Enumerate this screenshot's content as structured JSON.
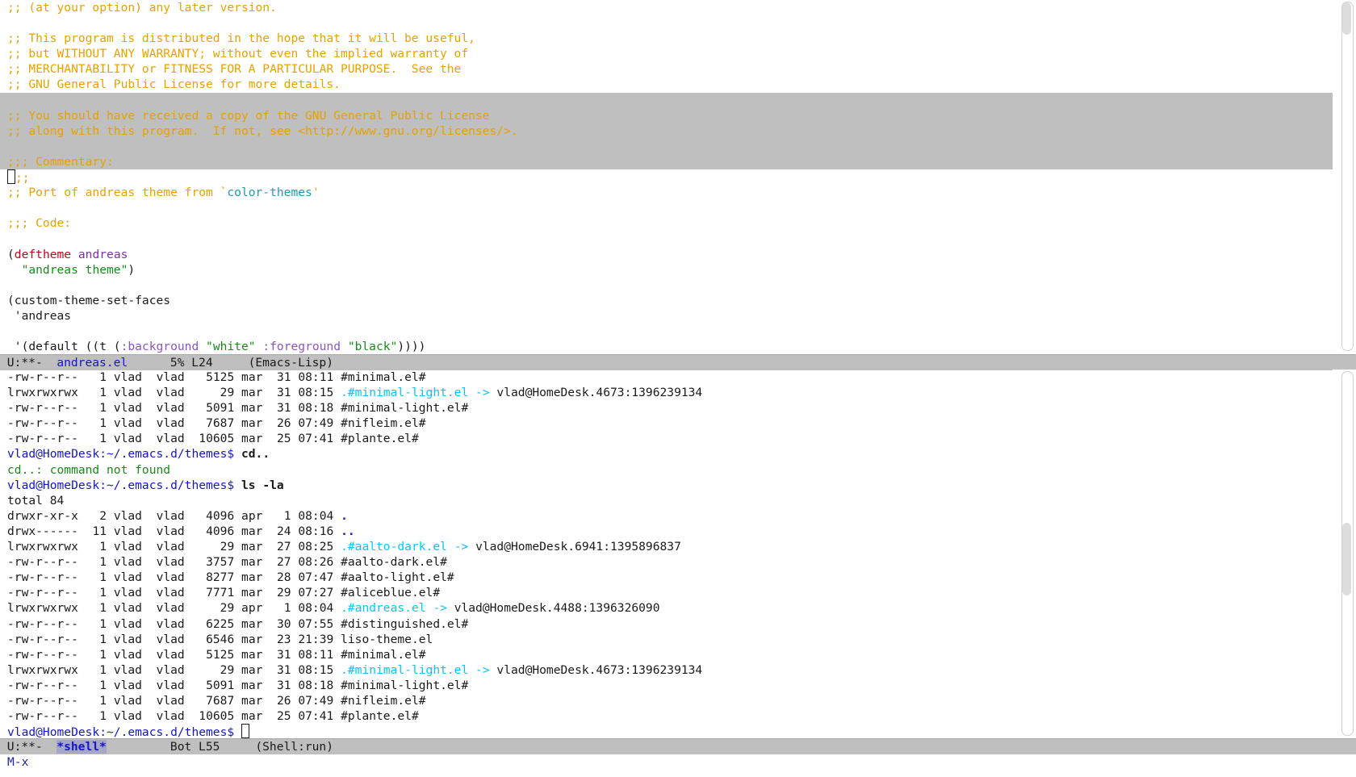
{
  "editor": {
    "lines": [
      ";; (at your option) any later version.",
      "",
      ";; This program is distributed in the hope that it will be useful,",
      ";; but WITHOUT ANY WARRANTY; without even the implied warranty of",
      ";; MERCHANTABILITY or FITNESS FOR A PARTICULAR PURPOSE.  See the",
      ";; GNU General Public License for more details.",
      "",
      ";; You should have received a copy of the GNU General Public License",
      ";; along with this program.  If not, see <http://www.gnu.org/licenses/>.",
      "",
      ";;; Commentary:",
      ";;",
      ";; Port of andreas theme from `",
      "color-themes",
      "'",
      "",
      ";;; Code:",
      "",
      "(",
      "deftheme",
      "andreas",
      "\"andreas theme\"",
      ")",
      "",
      "(custom-theme-set-faces",
      " 'andreas",
      "",
      " '(default ((t (",
      ":background",
      "\"white\"",
      ":foreground",
      "\"black\"",
      "))))"
    ]
  },
  "modeline_top": {
    "status": "U:**-",
    "buffer": "andreas.el",
    "position": "5% L24",
    "mode": "(Emacs-Lisp)"
  },
  "shell": {
    "listing_a": [
      {
        "perm": "-rw-r--r--",
        "n": "1",
        "u": "vlad",
        "g": "vlad",
        "size": "5125",
        "mon": "mar",
        "day": "31",
        "time": "08:11",
        "name": "#minimal.el#"
      },
      {
        "perm": "lrwxrwxrwx",
        "n": "1",
        "u": "vlad",
        "g": "vlad",
        "size": "29",
        "mon": "mar",
        "day": "31",
        "time": "08:15",
        "name": ".#minimal-light.el",
        "arrow": "->",
        "target": "vlad@HomeDesk.4673:1396239134"
      },
      {
        "perm": "-rw-r--r--",
        "n": "1",
        "u": "vlad",
        "g": "vlad",
        "size": "5091",
        "mon": "mar",
        "day": "31",
        "time": "08:18",
        "name": "#minimal-light.el#"
      },
      {
        "perm": "-rw-r--r--",
        "n": "1",
        "u": "vlad",
        "g": "vlad",
        "size": "7687",
        "mon": "mar",
        "day": "26",
        "time": "07:49",
        "name": "#nifleim.el#"
      },
      {
        "perm": "-rw-r--r--",
        "n": "1",
        "u": "vlad",
        "g": "vlad",
        "size": "10605",
        "mon": "mar",
        "day": "25",
        "time": "07:41",
        "name": "#plante.el#"
      }
    ],
    "prompt": "vlad@HomeDesk:~/.emacs.d/themes$",
    "cmd1": "cd..",
    "error": "cd..: command not found",
    "cmd2": "ls -la",
    "total": "total 84",
    "listing_b": [
      {
        "perm": "drwxr-xr-x",
        "n": "2",
        "u": "vlad",
        "g": "vlad",
        "size": "4096",
        "mon": "apr",
        "day": "1",
        "time": "08:04",
        "name": "."
      },
      {
        "perm": "drwx------",
        "n": "11",
        "u": "vlad",
        "g": "vlad",
        "size": "4096",
        "mon": "mar",
        "day": "24",
        "time": "08:16",
        "name": ".."
      },
      {
        "perm": "lrwxrwxrwx",
        "n": "1",
        "u": "vlad",
        "g": "vlad",
        "size": "29",
        "mon": "mar",
        "day": "27",
        "time": "08:25",
        "name": ".#aalto-dark.el",
        "arrow": "->",
        "target": "vlad@HomeDesk.6941:1395896837"
      },
      {
        "perm": "-rw-r--r--",
        "n": "1",
        "u": "vlad",
        "g": "vlad",
        "size": "3757",
        "mon": "mar",
        "day": "27",
        "time": "08:26",
        "name": "#aalto-dark.el#"
      },
      {
        "perm": "-rw-r--r--",
        "n": "1",
        "u": "vlad",
        "g": "vlad",
        "size": "8277",
        "mon": "mar",
        "day": "28",
        "time": "07:47",
        "name": "#aalto-light.el#"
      },
      {
        "perm": "-rw-r--r--",
        "n": "1",
        "u": "vlad",
        "g": "vlad",
        "size": "7771",
        "mon": "mar",
        "day": "29",
        "time": "07:27",
        "name": "#aliceblue.el#"
      },
      {
        "perm": "lrwxrwxrwx",
        "n": "1",
        "u": "vlad",
        "g": "vlad",
        "size": "29",
        "mon": "apr",
        "day": "1",
        "time": "08:04",
        "name": ".#andreas.el",
        "arrow": "->",
        "target": "vlad@HomeDesk.4488:1396326090"
      },
      {
        "perm": "-rw-r--r--",
        "n": "1",
        "u": "vlad",
        "g": "vlad",
        "size": "6225",
        "mon": "mar",
        "day": "30",
        "time": "07:55",
        "name": "#distinguished.el#"
      },
      {
        "perm": "-rw-r--r--",
        "n": "1",
        "u": "vlad",
        "g": "vlad",
        "size": "6546",
        "mon": "mar",
        "day": "23",
        "time": "21:39",
        "name": "liso-theme.el"
      },
      {
        "perm": "-rw-r--r--",
        "n": "1",
        "u": "vlad",
        "g": "vlad",
        "size": "5125",
        "mon": "mar",
        "day": "31",
        "time": "08:11",
        "name": "#minimal.el#"
      },
      {
        "perm": "lrwxrwxrwx",
        "n": "1",
        "u": "vlad",
        "g": "vlad",
        "size": "29",
        "mon": "mar",
        "day": "31",
        "time": "08:15",
        "name": ".#minimal-light.el",
        "arrow": "->",
        "target": "vlad@HomeDesk.4673:1396239134"
      },
      {
        "perm": "-rw-r--r--",
        "n": "1",
        "u": "vlad",
        "g": "vlad",
        "size": "5091",
        "mon": "mar",
        "day": "31",
        "time": "08:18",
        "name": "#minimal-light.el#"
      },
      {
        "perm": "-rw-r--r--",
        "n": "1",
        "u": "vlad",
        "g": "vlad",
        "size": "7687",
        "mon": "mar",
        "day": "26",
        "time": "07:49",
        "name": "#nifleim.el#"
      },
      {
        "perm": "-rw-r--r--",
        "n": "1",
        "u": "vlad",
        "g": "vlad",
        "size": "10605",
        "mon": "mar",
        "day": "25",
        "time": "07:41",
        "name": "#plante.el#"
      }
    ]
  },
  "modeline_bottom": {
    "status": "U:**-",
    "buffer": "*shell*",
    "position": "Bot L55",
    "mode": "(Shell:run)"
  },
  "minibuffer": {
    "text": "M-x"
  },
  "colors": {
    "comment": "#e8a100",
    "keyword": "#c8001e",
    "string": "#1a8a1a",
    "prompt": "#1515c8",
    "symlink": "#00c8ff",
    "region": "#bfbfbf",
    "modeline": "#bfbfbf"
  }
}
